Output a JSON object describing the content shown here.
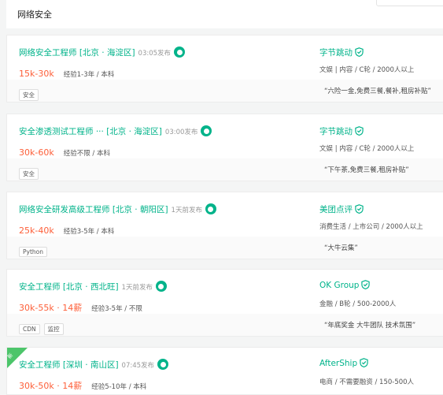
{
  "header": {
    "title": "网络安全"
  },
  "jobs": [
    {
      "title": "网络安全工程师 [北京 · 海淀区]",
      "posted": "03:05发布",
      "salary": "15k-30k",
      "requirements": "经验1-3年 / 本科",
      "company": "字节跳动",
      "industry": "文娱 | 内容 / C轮 / 2000人以上",
      "tags": [
        "安全"
      ],
      "benefits": "“六险一金,免费三餐,餐补,租房补贴”"
    },
    {
      "title": "安全渗透测试工程师 ···  [北京 · 海淀区]",
      "posted": "03:00发布",
      "salary": "30k-60k",
      "requirements": "经验不限 / 本科",
      "company": "字节跳动",
      "industry": "文娱 | 内容 / C轮 / 2000人以上",
      "tags": [
        "安全"
      ],
      "benefits": "“下午茶,免费三餐,租房补贴”"
    },
    {
      "title": "网络安全研发高级工程师 [北京 · 朝阳区]",
      "posted": "1天前发布",
      "salary": "25k-40k",
      "requirements": "经验3-5年 / 本科",
      "company": "美团点评",
      "industry": "消费生活 / 上市公司 / 2000人以上",
      "tags": [
        "Python"
      ],
      "benefits": "“大牛云集”"
    },
    {
      "title": "安全工程师 [北京 · 西北旺]",
      "posted": "1天前发布",
      "salary": "30k-55k · 14薪",
      "requirements": "经验3-5年 / 不限",
      "company": "OK Group",
      "industry": "金融 / B轮 / 500-2000人",
      "tags": [
        "CDN",
        "监控"
      ],
      "benefits": "“年底奖金 大牛团队 技术氛围”"
    },
    {
      "title": "安全工程师 [深圳 · 南山区]",
      "posted": "07:45发布",
      "salary": "30k-50k · 14薪",
      "requirements": "经验5-10年 / 本科",
      "company": "AfterShip",
      "industry": "电商 / 不需要融资 / 150-500人",
      "badge": "新",
      "tags": [],
      "benefits": ""
    }
  ]
}
